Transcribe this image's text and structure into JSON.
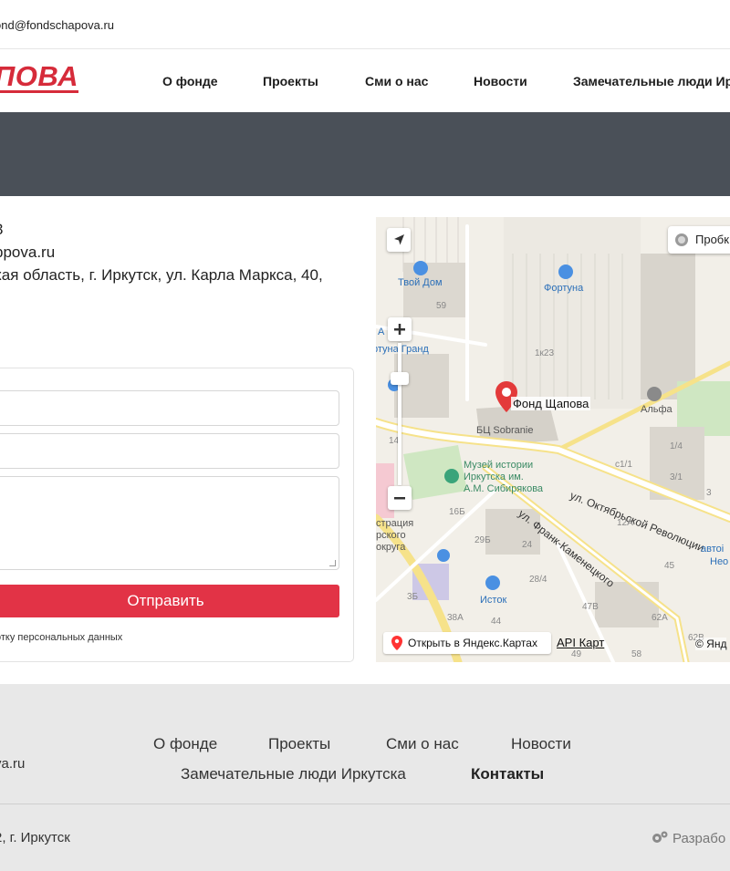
{
  "topbar": {
    "email": "ond@fondschapova.ru"
  },
  "header": {
    "logo_text": "ПОВА",
    "nav": [
      "О фонде",
      "Проекты",
      "Сми о нас",
      "Новости",
      "Замечательные люди Ирк"
    ]
  },
  "contacts": {
    "phone_tail": "3",
    "site": "ppova.ru",
    "address": "кая область, г. Иркутск, ул. Карла Маркса, 40,"
  },
  "form": {
    "submit_label": "Отправить",
    "consent": "отку персональных данных"
  },
  "map": {
    "traffic_label": "Пробк",
    "place_name": "Фонд Щапова",
    "labels": {
      "tvoy_dom": "Твой Дом",
      "fortuna": "Фортуна",
      "fortuna_grand": "ртуна Гранд",
      "alfa": "Альфа",
      "bc": "БЦ Sobranie",
      "museum1": "Музей истории",
      "museum2": "Иркутска им.",
      "museum3": "А.М. Сибирякова",
      "oct_rev": "ул. Октябрьской Революции",
      "frank": "ул. Франк-Каменецкого",
      "istok": "Исток",
      "admin1": "страция",
      "admin2": "рского",
      "admin3": "округа",
      "auto1": "автоі",
      "auto2": "Нео",
      "a": "А",
      "n59": "59",
      "n1k23": "1к23",
      "n14": "14",
      "n1_4": "1/4",
      "n3_1": "3/1",
      "nc1_1": "с1/1",
      "n3": "3",
      "n16b": "16Б",
      "n29b": "29Б",
      "n24": "24",
      "n12a": "12А",
      "n45": "45",
      "n28_4": "28/4",
      "n3b": "3Б",
      "n47b": "47В",
      "n38a": "38А",
      "n44": "44",
      "n62a": "62А",
      "n62b": "62В",
      "n49": "49",
      "n58": "58"
    },
    "open_label": "Открыть в Яндекс.Картах",
    "api_label": "API Карт",
    "copyright": "© Янд"
  },
  "footer": {
    "nav": [
      "О фонде",
      "Проекты",
      "Сми о нас",
      "Новости",
      "Замечательные люди Иркутска",
      "Контакты"
    ],
    "site": "va.ru",
    "address": "2, г. Иркутск",
    "dev": "Разрабо"
  },
  "colors": {
    "accent": "#e23346",
    "banner": "#4a5058",
    "footer_bg": "#e8e8e8"
  }
}
